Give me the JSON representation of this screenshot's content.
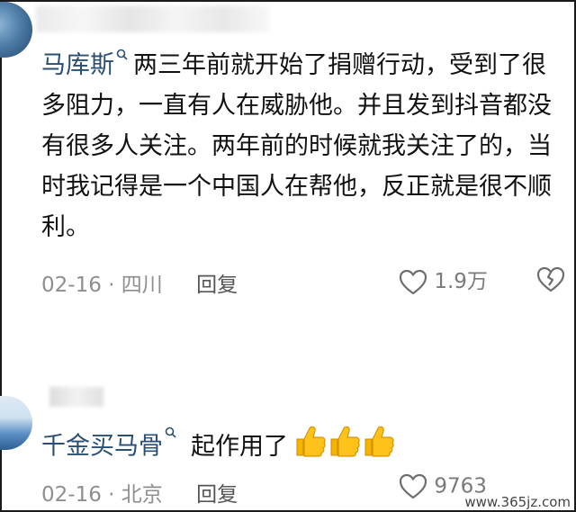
{
  "comments": [
    {
      "username": "马库斯",
      "text": "两三年前就开始了捐赠行动，受到了很多阻力，一直有人在威胁他。并且发到抖音都没有很多人关注。两年前的时候就我关注了的，当时我记得是一个中国人在帮他，反正就是很不顺利。",
      "date": "02-16",
      "location": "四川",
      "reply_label": "回复",
      "likes": "1.9万"
    },
    {
      "username": "千金买马骨",
      "text": "起作用了",
      "date": "02-16",
      "location": "北京",
      "reply_label": "回复",
      "likes": "9763"
    }
  ],
  "meta_separator": "·",
  "watermark": "www.365jz.com",
  "icons": {
    "search": "search-icon",
    "like": "heart-outline-icon",
    "dislike": "broken-heart-icon",
    "thumbs": "thumbs-up-emoji"
  },
  "colors": {
    "username": "#2b4f73",
    "text": "#111111",
    "meta": "#8e8e8e",
    "thumbs": "#f5b400"
  }
}
